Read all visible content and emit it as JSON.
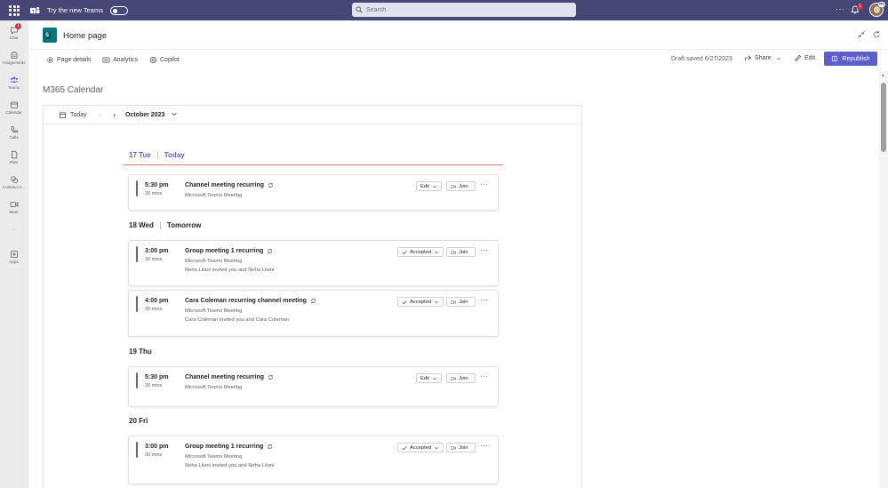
{
  "topbar": {
    "try_new_teams": "Try the new Teams",
    "search_placeholder": "Search",
    "more": "···",
    "notification_count": "1",
    "avatar_badge": "P5"
  },
  "rail": {
    "items": [
      {
        "label": "Chat",
        "icon": "chat-icon",
        "badge": "1"
      },
      {
        "label": "Assignments",
        "icon": "assignments-icon"
      },
      {
        "label": "Teams",
        "icon": "teams-icon"
      },
      {
        "label": "Calendar",
        "icon": "calendar-icon"
      },
      {
        "label": "Calls",
        "icon": "calls-icon"
      },
      {
        "label": "Files",
        "icon": "files-icon"
      },
      {
        "label": "Contoso U...",
        "icon": "contoso-app-icon"
      },
      {
        "label": "Meet",
        "icon": "meet-icon"
      },
      {
        "label": "···",
        "icon": "more-apps-icon"
      },
      {
        "label": "Apps",
        "icon": "apps-icon"
      }
    ]
  },
  "page": {
    "title": "Home page",
    "commands": {
      "page_details": "Page details",
      "analytics": "Analytics",
      "copilot": "Copilot"
    },
    "draft_status": "Draft saved 6/27/2023",
    "share": "Share",
    "edit": "Edit",
    "republish": "Republish",
    "section_title": "M365 Calendar"
  },
  "calendar": {
    "today_button": "Today",
    "month": "October 2023",
    "days": [
      {
        "label": "17 Tue",
        "relative": "Today",
        "events": [
          {
            "time": "5:30 pm",
            "duration": "30 mins",
            "title": "Channel meeting recurring",
            "subtitle": "Microsoft Teams Meeting",
            "invite": "",
            "action": "Edit",
            "join": "Join"
          }
        ]
      },
      {
        "label": "18 Wed",
        "relative": "Tomorrow",
        "events": [
          {
            "time": "3:00 pm",
            "duration": "30 mins",
            "title": "Group meeting 1 recurring",
            "subtitle": "Microsoft Teams Meeting",
            "invite": "Neha Lilani invited you and Neha Lilani",
            "action": "Accepted",
            "join": "Join"
          },
          {
            "time": "4:00 pm",
            "duration": "30 mins",
            "title": "Cara Coleman recurring channel meeting",
            "subtitle": "Microsoft Teams Meeting",
            "invite": "Cara Coleman invited you and Cara Coleman",
            "action": "Accepted",
            "join": "Join"
          }
        ]
      },
      {
        "label": "19 Thu",
        "relative": "",
        "events": [
          {
            "time": "5:30 pm",
            "duration": "30 mins",
            "title": "Channel meeting recurring",
            "subtitle": "Microsoft Teams Meeting",
            "invite": "",
            "action": "Edit",
            "join": "Join"
          }
        ]
      },
      {
        "label": "20 Fri",
        "relative": "",
        "events": [
          {
            "time": "3:00 pm",
            "duration": "30 mins",
            "title": "Group meeting 1 recurring",
            "subtitle": "Microsoft Teams Meeting",
            "invite": "Neha Lilani invited you and Neha Lilani",
            "action": "Accepted",
            "join": "Join"
          }
        ]
      }
    ]
  },
  "colors": {
    "teams_bar": "#464775",
    "accent": "#5b5fc7",
    "today_line": "#e57363",
    "badge": "#c4314b"
  }
}
